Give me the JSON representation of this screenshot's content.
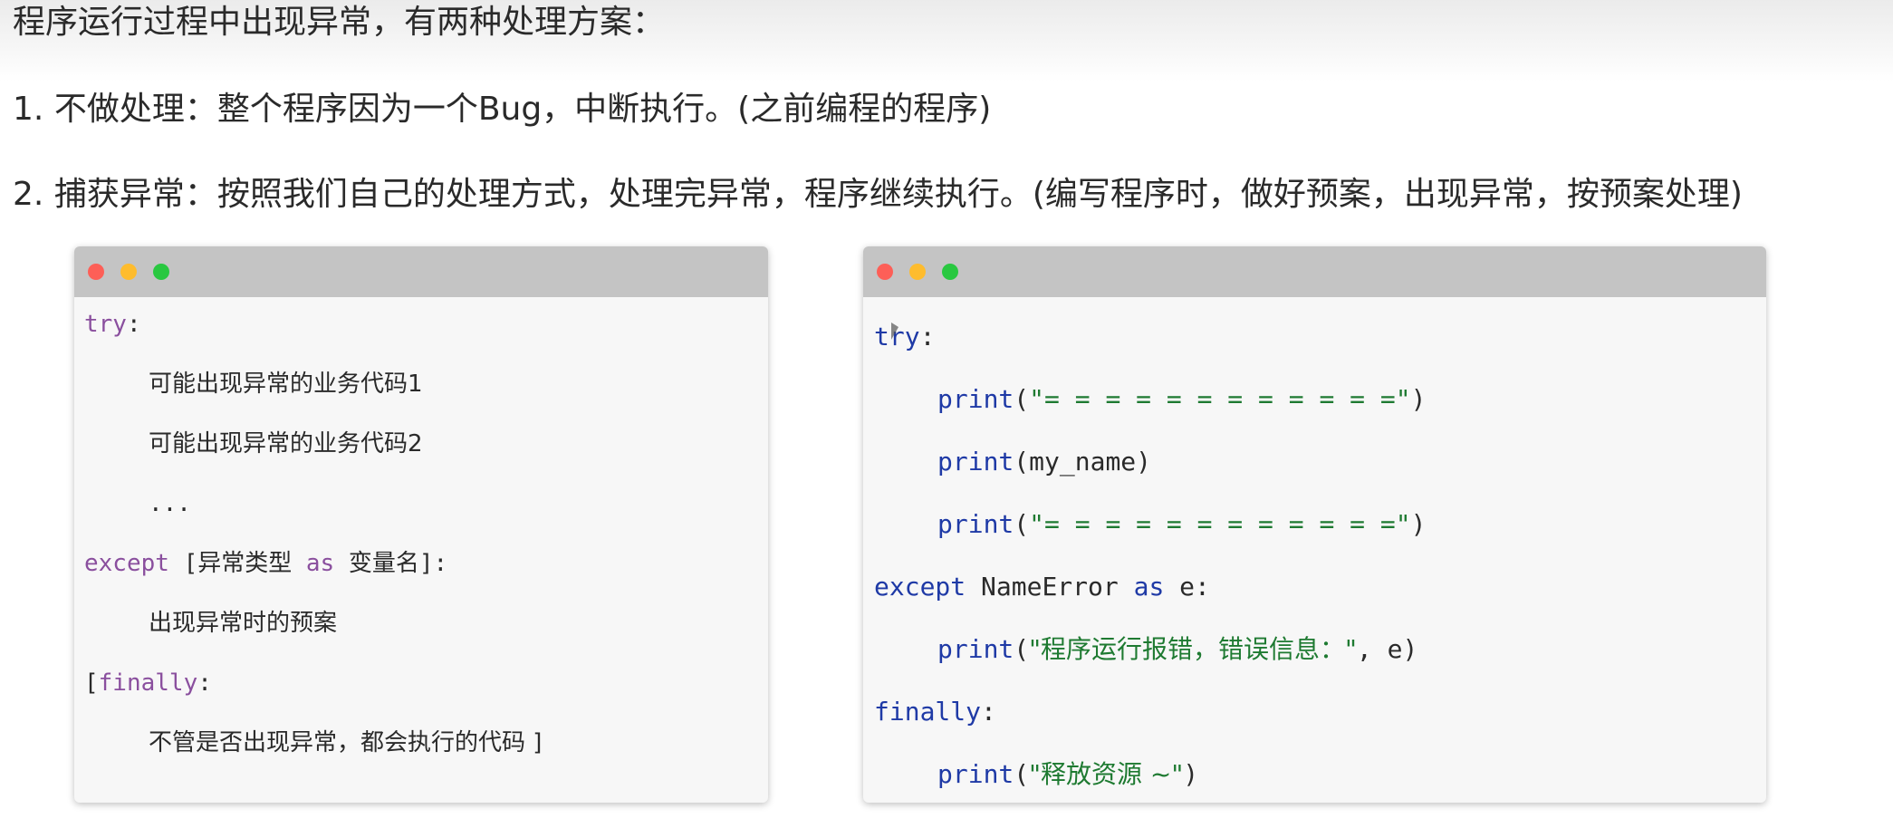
{
  "intro": "程序运行过程中出现异常，有两种处理方案：",
  "options": [
    {
      "number": "1.",
      "text": "不做处理：整个程序因为一个Bug，中断执行。(之前编程的程序)"
    },
    {
      "number": "2.",
      "text": "捕获异常：按照我们自己的处理方式，处理完异常，程序继续执行。(编写程序时，做好预案，出现异常，按预案处理)"
    }
  ],
  "syntax_window": {
    "try_kw": "try",
    "colon": ":",
    "line1": "可能出现异常的业务代码1",
    "line2": "可能出现异常的业务代码2",
    "ellipsis": "...",
    "except_kw": "except",
    "bracket_open": " [",
    "exception_type": "异常类型",
    "as_kw": " as ",
    "var_name": "变量名",
    "bracket_close": "]:",
    "except_body": "出现异常时的预案",
    "finally_open": "[",
    "finally_kw": "finally",
    "finally_colon": ":",
    "finally_body": "不管是否出现异常，都会执行的代码 ]"
  },
  "example_window": {
    "try_kw": "try",
    "colon": ":",
    "print_kw": "print",
    "paren_open": "(",
    "paren_close": ")",
    "separator_str": "\"= = = = = = = = = = = =\"",
    "my_name": "my_name",
    "except_kw": "except",
    "error_name": " NameError",
    "as_kw": " as",
    "e_var": " e:",
    "error_msg_str": "\"程序运行报错，错误信息：\"",
    "error_msg_rest": ", e)",
    "finally_kw": "finally",
    "release_str": "\"释放资源 ~\""
  },
  "colors": {
    "keyword_purple": "#8a4f9e",
    "keyword_blue": "#1f3aa6",
    "string_green": "#1e7a31",
    "titlebar_gray": "#c4c4c4",
    "close_red": "#fd5f57",
    "minimize_yellow": "#febc2e",
    "maximize_green": "#29c840"
  }
}
